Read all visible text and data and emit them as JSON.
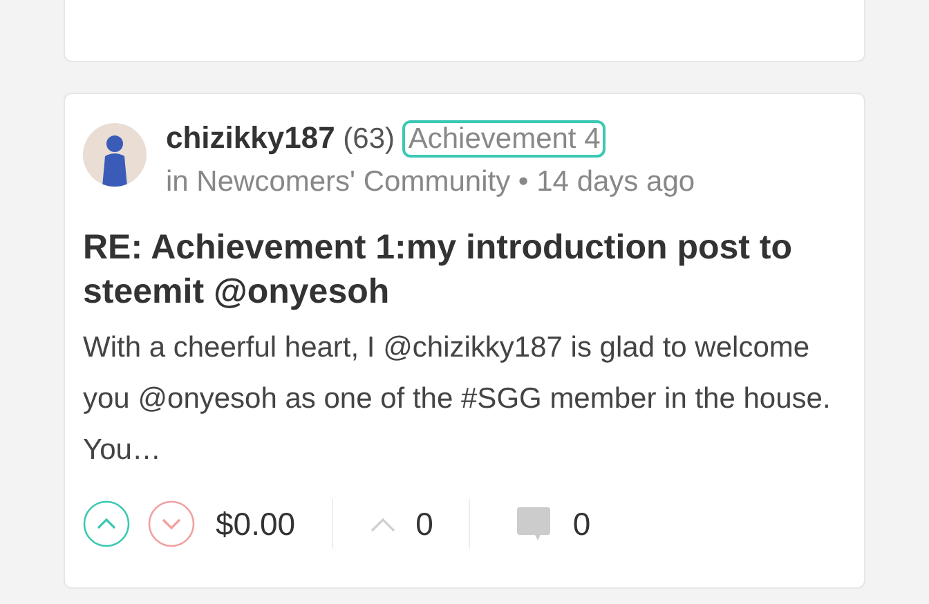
{
  "posts": [
    {
      "author": "chizikky187",
      "reputation": "(63)",
      "tag": "Achievement 4",
      "community": "in Newcomers' Community",
      "separator": "•",
      "time": "14 days ago",
      "title": "RE: Achievement 1:my introduction post to steemit @onyesoh",
      "excerpt": "With a cheerful heart, I @chizikky187 is glad to welcome you @onyesoh as one of the #SGG member in the house. You…",
      "payout": "$0.00",
      "reblogs": "0",
      "comments": "0"
    }
  ]
}
